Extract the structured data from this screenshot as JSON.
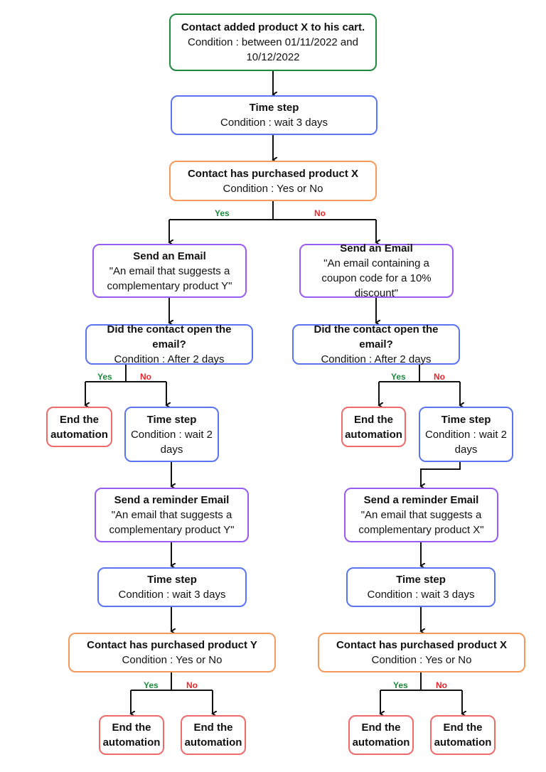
{
  "colors": {
    "trigger": "#1e8a3e",
    "time": "#5b74f2",
    "condition": "#f59a5b",
    "email": "#9a5cf0",
    "end": "#ef6b6b",
    "yes_label": "#1e8a3e",
    "no_label": "#e8262b",
    "edge": "#111111"
  },
  "nodes": {
    "trigger": {
      "title": "Contact added product X to his cart.",
      "body": "Condition : between 01/11/2022 and 10/12/2022"
    },
    "wait3": {
      "title": "Time step",
      "body": "Condition : wait 3 days"
    },
    "purchasedX": {
      "title": "Contact has purchased product X",
      "body": "Condition : Yes or No"
    },
    "left": {
      "email": {
        "title": "Send an Email",
        "body": "\"An email that suggests a complementary product Y\""
      },
      "opened": {
        "title": "Did the contact open the email?",
        "body": "Condition : After 2 days"
      },
      "end_yes": {
        "title": "End the automation"
      },
      "wait2": {
        "title": "Time step",
        "body": "Condition : wait 2 days"
      },
      "reminder": {
        "title": "Send a reminder Email",
        "body": "\"An email that suggests a complementary product Y\""
      },
      "wait3": {
        "title": "Time step",
        "body": "Condition : wait 3 days"
      },
      "purchased": {
        "title": "Contact has purchased product Y",
        "body": "Condition : Yes or No"
      },
      "end_final_yes": {
        "title": "End the automation"
      },
      "end_final_no": {
        "title": "End the automation"
      }
    },
    "right": {
      "email": {
        "title": "Send an Email",
        "body": "\"An email containing a coupon code for a 10% discount\""
      },
      "opened": {
        "title": "Did the contact open the email?",
        "body": "Condition : After 2 days"
      },
      "end_yes": {
        "title": "End the automation"
      },
      "wait2": {
        "title": "Time step",
        "body": "Condition : wait 2 days"
      },
      "reminder": {
        "title": "Send a reminder Email",
        "body": "\"An email that suggests a complementary product X\""
      },
      "wait3": {
        "title": "Time step",
        "body": "Condition : wait 3 days"
      },
      "purchased": {
        "title": "Contact has purchased product X",
        "body": "Condition : Yes or No"
      },
      "end_final_yes": {
        "title": "End the automation"
      },
      "end_final_no": {
        "title": "End the automation"
      }
    }
  },
  "branch_labels": {
    "yes": "Yes",
    "no": "No"
  }
}
